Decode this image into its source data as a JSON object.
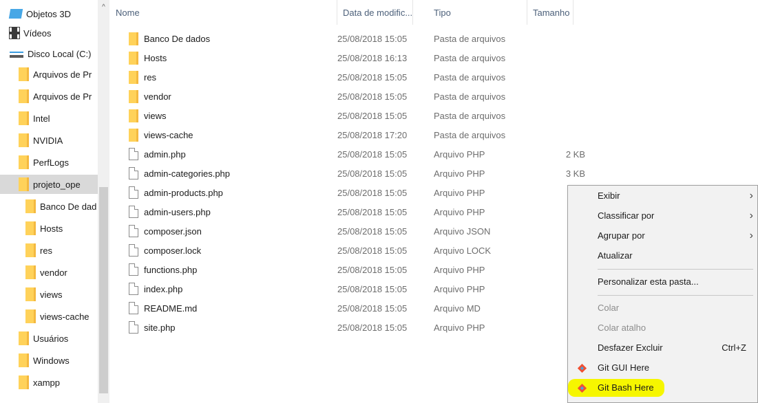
{
  "nav": {
    "items": [
      {
        "label": "Objetos 3D",
        "icon": "objects-3d-icon",
        "indent": 0
      },
      {
        "label": "Vídeos",
        "icon": "video-icon",
        "indent": 0
      },
      {
        "label": "Disco Local (C:)",
        "icon": "local-disk-icon",
        "indent": 0
      },
      {
        "label": "Arquivos de Pr",
        "icon": "folder-icon",
        "indent": 1
      },
      {
        "label": "Arquivos de Pr",
        "icon": "folder-icon",
        "indent": 1
      },
      {
        "label": "Intel",
        "icon": "folder-icon",
        "indent": 1
      },
      {
        "label": "NVIDIA",
        "icon": "folder-icon",
        "indent": 1
      },
      {
        "label": "PerfLogs",
        "icon": "folder-icon",
        "indent": 1
      },
      {
        "label": "projeto_ope",
        "icon": "folder-icon",
        "indent": 1,
        "selected": true
      },
      {
        "label": "Banco De dad",
        "icon": "folder-icon",
        "indent": 2
      },
      {
        "label": "Hosts",
        "icon": "folder-icon",
        "indent": 2
      },
      {
        "label": "res",
        "icon": "folder-icon",
        "indent": 2
      },
      {
        "label": "vendor",
        "icon": "folder-icon",
        "indent": 2
      },
      {
        "label": "views",
        "icon": "folder-icon",
        "indent": 2
      },
      {
        "label": "views-cache",
        "icon": "folder-icon",
        "indent": 2
      },
      {
        "label": "Usuários",
        "icon": "folder-icon",
        "indent": 1
      },
      {
        "label": "Windows",
        "icon": "folder-icon",
        "indent": 1
      },
      {
        "label": "xampp",
        "icon": "folder-icon",
        "indent": 1
      }
    ]
  },
  "columns": {
    "name": "Nome",
    "date": "Data de modific...",
    "type": "Tipo",
    "size": "Tamanho"
  },
  "files": [
    {
      "name": "Banco De dados",
      "date": "25/08/2018 15:05",
      "type": "Pasta de arquivos",
      "size": "",
      "kind": "folder"
    },
    {
      "name": "Hosts",
      "date": "25/08/2018 16:13",
      "type": "Pasta de arquivos",
      "size": "",
      "kind": "folder"
    },
    {
      "name": "res",
      "date": "25/08/2018 15:05",
      "type": "Pasta de arquivos",
      "size": "",
      "kind": "folder"
    },
    {
      "name": "vendor",
      "date": "25/08/2018 15:05",
      "type": "Pasta de arquivos",
      "size": "",
      "kind": "folder"
    },
    {
      "name": "views",
      "date": "25/08/2018 15:05",
      "type": "Pasta de arquivos",
      "size": "",
      "kind": "folder"
    },
    {
      "name": "views-cache",
      "date": "25/08/2018 17:20",
      "type": "Pasta de arquivos",
      "size": "",
      "kind": "folder"
    },
    {
      "name": "admin.php",
      "date": "25/08/2018 15:05",
      "type": "Arquivo PHP",
      "size": "2 KB",
      "kind": "file"
    },
    {
      "name": "admin-categories.php",
      "date": "25/08/2018 15:05",
      "type": "Arquivo PHP",
      "size": "3 KB",
      "kind": "file"
    },
    {
      "name": "admin-products.php",
      "date": "25/08/2018 15:05",
      "type": "Arquivo PHP",
      "size": "",
      "kind": "file"
    },
    {
      "name": "admin-users.php",
      "date": "25/08/2018 15:05",
      "type": "Arquivo PHP",
      "size": "",
      "kind": "file"
    },
    {
      "name": "composer.json",
      "date": "25/08/2018 15:05",
      "type": "Arquivo JSON",
      "size": "",
      "kind": "file"
    },
    {
      "name": "composer.lock",
      "date": "25/08/2018 15:05",
      "type": "Arquivo LOCK",
      "size": "",
      "kind": "file"
    },
    {
      "name": "functions.php",
      "date": "25/08/2018 15:05",
      "type": "Arquivo PHP",
      "size": "",
      "kind": "file"
    },
    {
      "name": "index.php",
      "date": "25/08/2018 15:05",
      "type": "Arquivo PHP",
      "size": "",
      "kind": "file"
    },
    {
      "name": "README.md",
      "date": "25/08/2018 15:05",
      "type": "Arquivo MD",
      "size": "",
      "kind": "file"
    },
    {
      "name": "site.php",
      "date": "25/08/2018 15:05",
      "type": "Arquivo PHP",
      "size": "",
      "kind": "file"
    }
  ],
  "context_menu": {
    "items": [
      {
        "label": "Exibir",
        "submenu": true
      },
      {
        "label": "Classificar por",
        "submenu": true
      },
      {
        "label": "Agrupar por",
        "submenu": true
      },
      {
        "label": "Atualizar"
      },
      {
        "separator": true
      },
      {
        "label": "Personalizar esta pasta..."
      },
      {
        "separator": true
      },
      {
        "label": "Colar",
        "disabled": true
      },
      {
        "label": "Colar atalho",
        "disabled": true
      },
      {
        "label": "Desfazer Excluir",
        "shortcut": "Ctrl+Z"
      },
      {
        "label": "Git GUI Here",
        "icon": "git-icon"
      },
      {
        "label": "Git Bash Here",
        "icon": "git-icon",
        "highlighted": true
      }
    ]
  },
  "colors": {
    "folder": "#ffd25a",
    "highlight": "#f6f600",
    "menu_bg": "#f2f2f2",
    "header_text": "#4c607a",
    "nav_selected": "#d9d9d9"
  }
}
